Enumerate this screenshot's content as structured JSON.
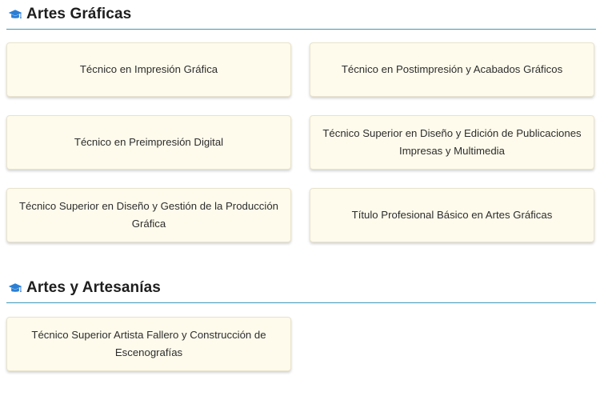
{
  "sections": [
    {
      "title": "Artes Gráficas",
      "icon": "graduation-cap-icon",
      "cards": [
        "Técnico en Impresión Gráfica",
        "Técnico en Postimpresión y Acabados Gráficos",
        "Técnico en Preimpresión Digital",
        "Técnico Superior en Diseño y Edición de Publicaciones Impresas y Multimedia",
        "Técnico Superior en Diseño y Gestión de la Producción Gráfica",
        "Título Profesional Básico en Artes Gráficas"
      ]
    },
    {
      "title": "Artes y Artesanías",
      "icon": "graduation-cap-icon",
      "cards": [
        "Técnico Superior Artista Fallero y Construcción de Escenografías"
      ]
    }
  ],
  "colors": {
    "accent_line": "#3d97b6",
    "icon": "#2a7fd4",
    "card_background": "#fefbec",
    "card_border": "#e9e3cc"
  }
}
